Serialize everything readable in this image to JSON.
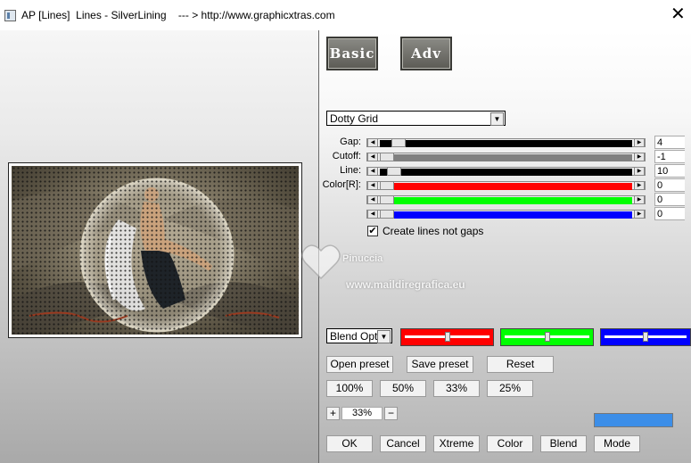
{
  "window": {
    "title": "AP [Lines]  Lines - SilverLining    --- > http://www.graphicxtras.com",
    "close_glyph": "✕"
  },
  "tabs": {
    "basic": "Basic",
    "adv": "Adv"
  },
  "effect_dropdown": {
    "value": "Dotty Grid"
  },
  "sliders": [
    {
      "label": "Gap:",
      "value": "4",
      "fill_color": "#000000",
      "level": 0.05
    },
    {
      "label": "Cutoff:",
      "value": "-1",
      "fill_color": "#808080",
      "level": 0.0
    },
    {
      "label": "Line:",
      "value": "10",
      "fill_color": "#000000",
      "level": 0.03
    },
    {
      "label": "Color[R]:",
      "value": "0",
      "fill_color": "#ff0000",
      "level": 0.0
    },
    {
      "label": "",
      "value": "0",
      "fill_color": "#00ff00",
      "level": 0.0
    },
    {
      "label": "",
      "value": "0",
      "fill_color": "#0000ff",
      "level": 0.0
    }
  ],
  "create_lines_checkbox": {
    "label": "Create lines not gaps",
    "checked": true,
    "check_glyph": "✔"
  },
  "blend_dropdown": {
    "value": "Blend Optio"
  },
  "color_sliders": [
    {
      "color": "#ff0000",
      "level": 0.5
    },
    {
      "color": "#00ff00",
      "level": 0.5
    },
    {
      "color": "#0000ff",
      "level": 0.5
    }
  ],
  "preset_buttons": {
    "open": "Open preset",
    "save": "Save preset",
    "reset": "Reset"
  },
  "zoom_buttons": [
    "100%",
    "50%",
    "33%",
    "25%"
  ],
  "zoom_control": {
    "plus": "+",
    "value": "33%",
    "minus": "−"
  },
  "indicator_color": "#3c8ee8",
  "bottom_buttons": {
    "ok": "OK",
    "cancel": "Cancel",
    "xtreme": "Xtreme",
    "color": "Color",
    "blend": "Blend",
    "mode": "Mode"
  },
  "watermark": {
    "name": "Pinuccia",
    "url": "www.maildiregrafica.eu"
  }
}
